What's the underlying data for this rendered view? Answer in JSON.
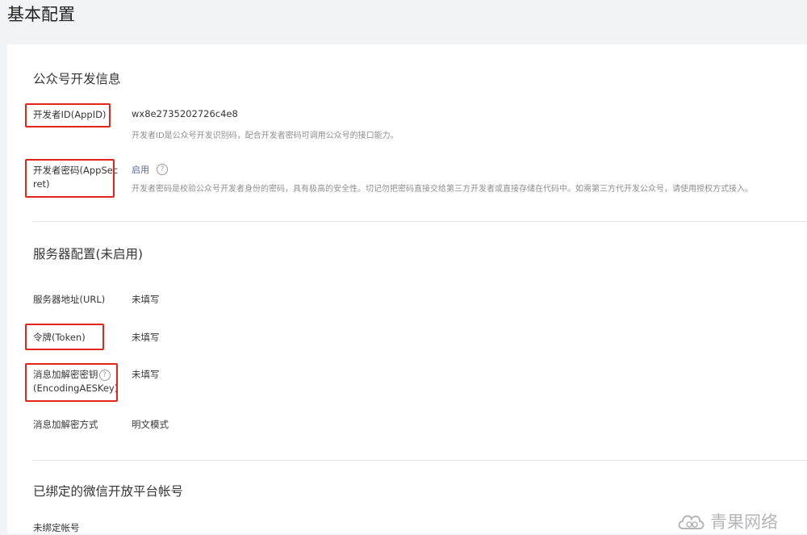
{
  "page_title": "基本配置",
  "sections": {
    "dev_info": {
      "title": "公众号开发信息",
      "appid": {
        "label": "开发者ID(AppID)",
        "value": "wx8e2735202726c4e8",
        "desc": "开发者ID是公众号开发识别码，配合开发者密码可调用公众号的接口能力。"
      },
      "appsecret": {
        "label_line1": "开发者密码(AppSec",
        "label_line2": "ret)",
        "action": "启用",
        "help_icon": "help-circle-icon",
        "desc": "开发者密码是校验公众号开发者身份的密码，具有极高的安全性。切记勿把密码直接交给第三方开发者或直接存储在代码中。如需第三方代开发公众号，请使用授权方式接入。"
      }
    },
    "server": {
      "title": "服务器配置(未启用)",
      "url": {
        "label": "服务器地址(URL)",
        "value": "未填写"
      },
      "token": {
        "label": "令牌(Token)",
        "value": "未填写"
      },
      "aeskey": {
        "label_line1": "消息加解密密钥",
        "label_line2": "(EncodingAESKey)",
        "help_icon": "help-circle-icon",
        "value": "未填写"
      },
      "mode": {
        "label": "消息加解密方式",
        "value": "明文模式"
      }
    },
    "open_platform": {
      "title": "已绑定的微信开放平台帐号",
      "unbound_label": "未绑定帐号"
    }
  },
  "watermark": {
    "text": "青果网络",
    "icon": "cloud-logo-icon"
  },
  "colors": {
    "highlight": "#e22518",
    "link": "#576b95",
    "muted": "#8d8d8d"
  }
}
